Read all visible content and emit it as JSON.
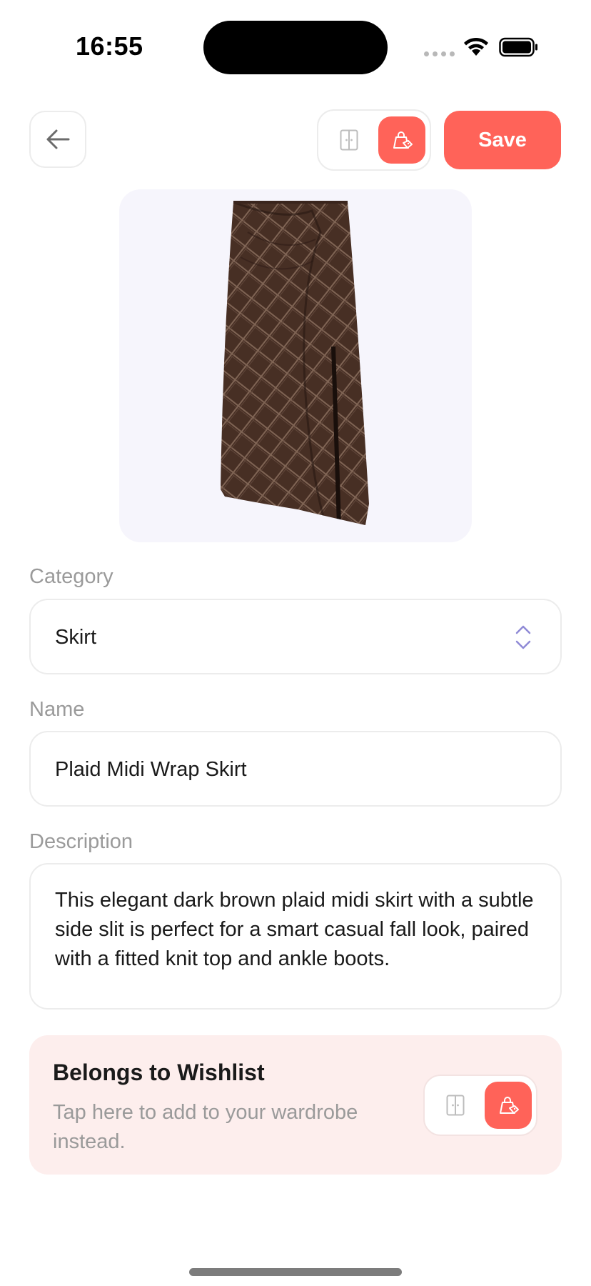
{
  "status_bar": {
    "time": "16:55"
  },
  "header": {
    "back_icon": "arrow-left-icon",
    "mode_toggle": {
      "options": [
        {
          "icon": "wardrobe-icon",
          "selected": false
        },
        {
          "icon": "shopping-bag-tag-icon",
          "selected": true
        }
      ]
    },
    "save_label": "Save"
  },
  "item_image": {
    "subject": "plaid-skirt-image"
  },
  "form": {
    "category": {
      "label": "Category",
      "value": "Skirt",
      "icon": "chevron-up-down-icon"
    },
    "name": {
      "label": "Name",
      "value": "Plaid Midi Wrap Skirt"
    },
    "description": {
      "label": "Description",
      "value": "This elegant dark brown plaid midi skirt with a subtle side slit is perfect for a smart casual fall look, paired with a fitted knit top and ankle boots."
    }
  },
  "wishlist_card": {
    "title": "Belongs to Wishlist",
    "subtitle": "Tap here to add to your wardrobe instead.",
    "toggle": {
      "options": [
        {
          "icon": "wardrobe-icon",
          "selected": false
        },
        {
          "icon": "shopping-bag-tag-icon",
          "selected": true
        }
      ]
    }
  },
  "colors": {
    "accent": "#ff6359",
    "label_gray": "#9a9a9a",
    "card_pink": "#fdeeed",
    "image_bg": "#f6f5fc",
    "chevron": "#8f8ad6"
  }
}
